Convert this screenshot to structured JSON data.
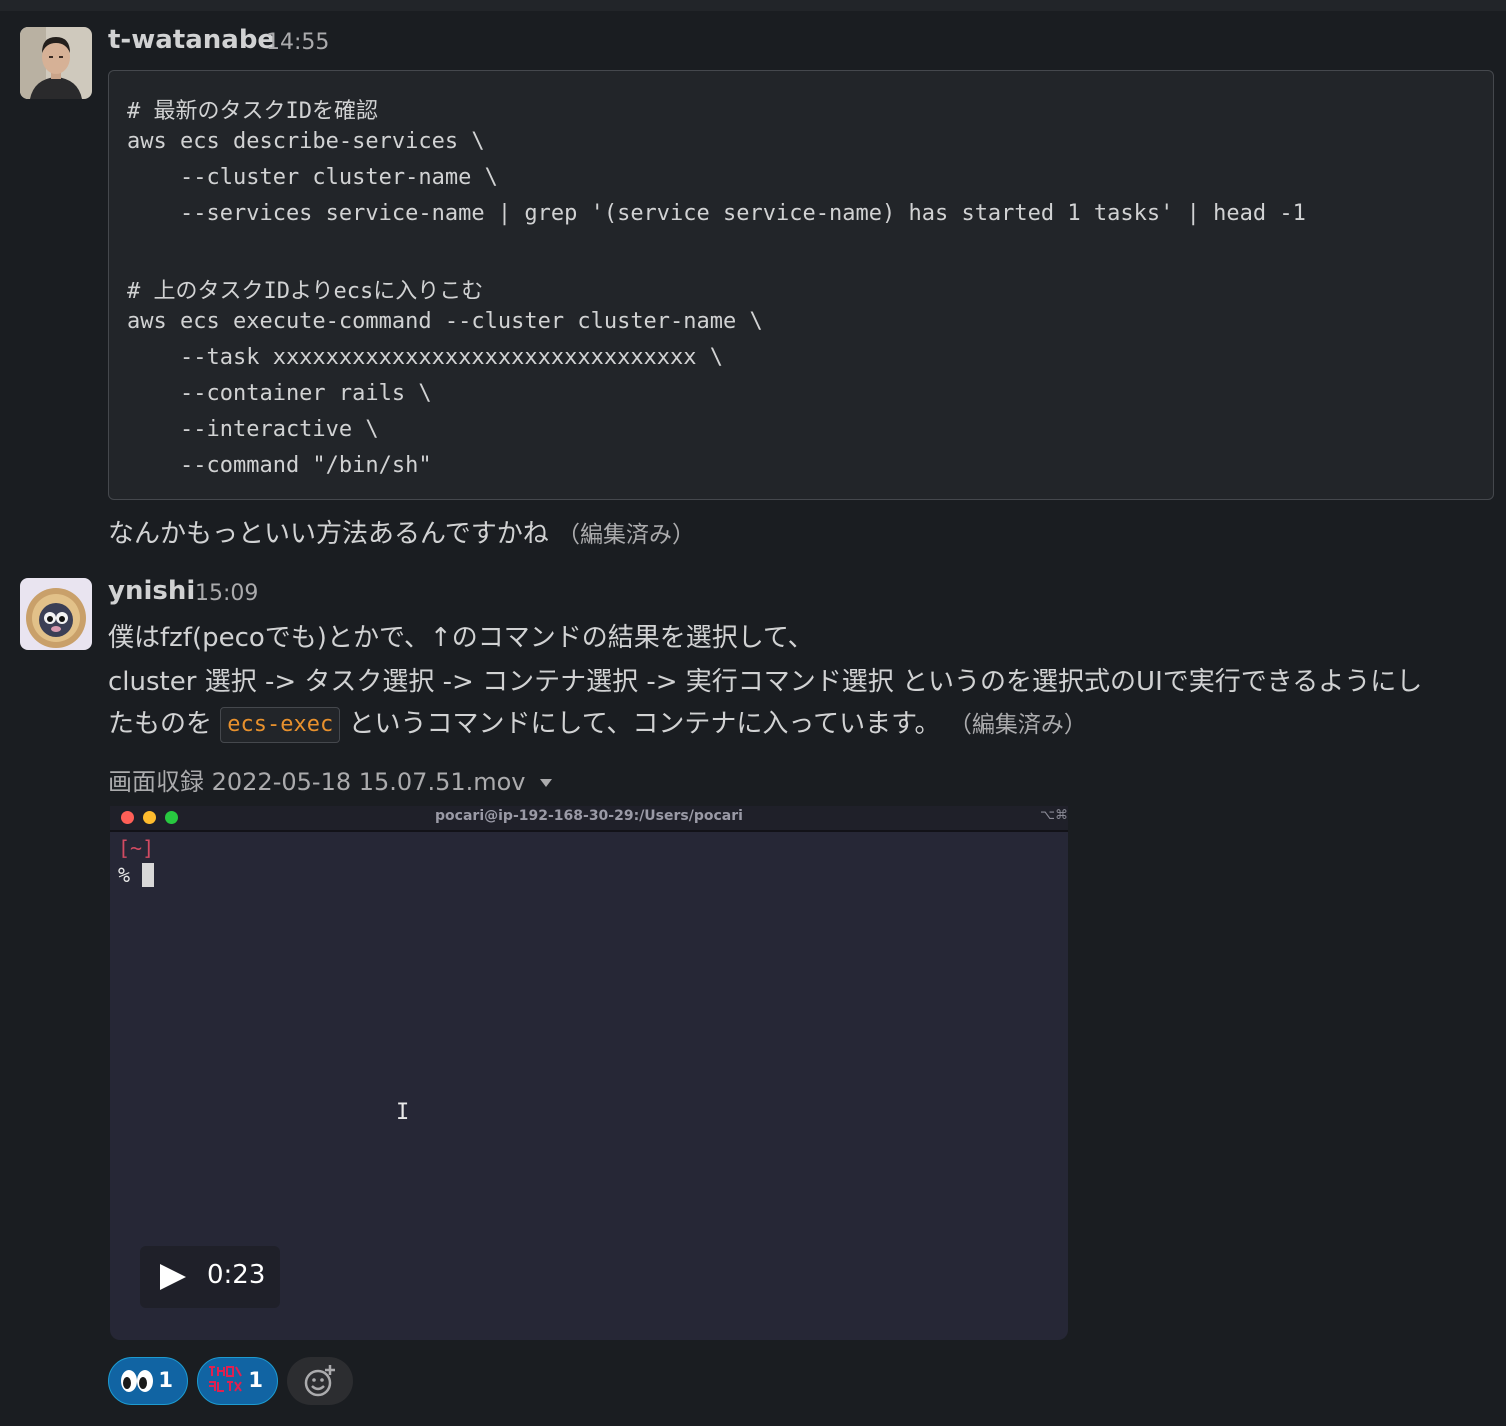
{
  "messages": [
    {
      "author": "t-watanabe",
      "time": "14:55",
      "code_lines": [
        "# 最新のタスクIDを確認",
        "aws ecs describe-services \\",
        "    --cluster cluster-name \\",
        "    --services service-name | grep '(service service-name) has started 1 tasks' | head -1",
        "",
        "# 上のタスクIDよりecsに入りこむ",
        "aws ecs execute-command --cluster cluster-name \\",
        "    --task xxxxxxxxxxxxxxxxxxxxxxxxxxxxxxxx \\",
        "    --container rails \\",
        "    --interactive \\",
        "    --command \"/bin/sh\""
      ],
      "text": "なんかもっといい方法あるんですかね",
      "edited": "（編集済み）"
    },
    {
      "author": "ynishi",
      "time": "15:09",
      "line1": "僕はfzf(pecoでも)とかで、↑のコマンドの結果を選択して、",
      "line2": "cluster 選択 -> タスク選択 -> コンテナ選択 -> 実行コマンド選択 というのを選択式のUIで実行できるようにし",
      "line3_before": "たものを",
      "inline_code": "ecs-exec",
      "line3_after": "というコマンドにして、コンテナに入っています。",
      "edited": "（編集済み）",
      "file_name": "画面収録 2022-05-18 15.07.51.mov",
      "video": {
        "terminal_title": "pocari@ip-192-168-30-29:/Users/pocari",
        "terminal_key_hint": "⌥⌘",
        "prompt_dir": "[~]",
        "prompt_symbol": "%",
        "mouse_cursor": "I",
        "duration": "0:23"
      },
      "reactions": [
        {
          "emoji": "eyes-emoji",
          "count": "1"
        },
        {
          "emoji": "custom-red-text-emoji",
          "count": "1"
        }
      ],
      "add_reaction_icon": "add-reaction-icon"
    }
  ],
  "colors": {
    "background": "#1a1d21",
    "text": "#d1d2d3",
    "muted": "#ababad",
    "inline_code": "#e8912d",
    "reaction_bg": "#1164a3",
    "reaction_border": "#1d9bd1"
  }
}
